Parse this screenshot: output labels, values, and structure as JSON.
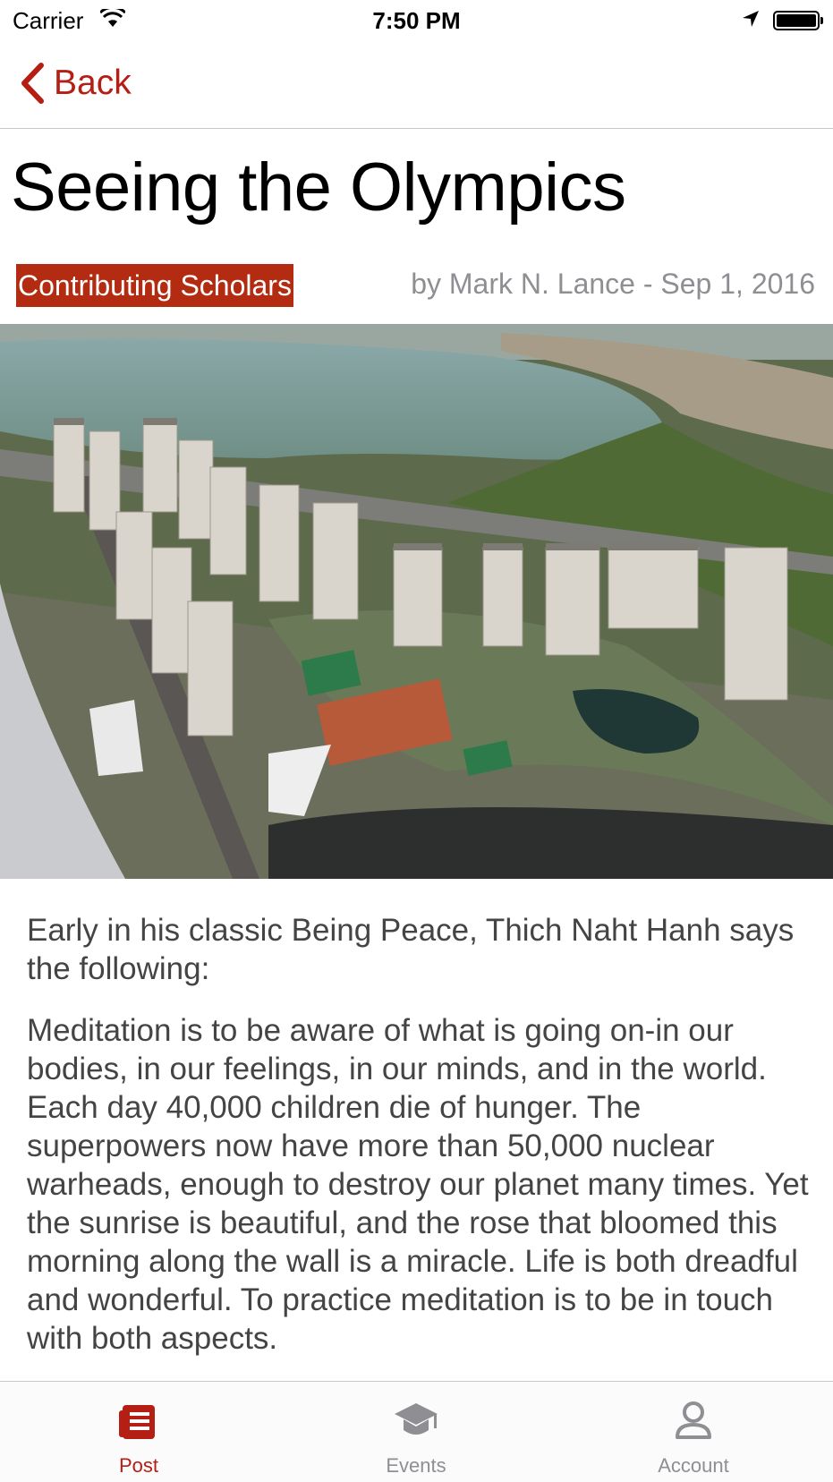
{
  "status_bar": {
    "carrier": "Carrier",
    "time": "7:50 PM",
    "icons": [
      "wifi-icon",
      "location-arrow-icon",
      "battery-icon"
    ]
  },
  "nav": {
    "back_label": "Back",
    "back_icon": "chevron-left-icon"
  },
  "article": {
    "title": "Seeing the Olympics",
    "category": "Contributing Scholars",
    "byline": "by Mark N. Lance - Sep 1, 2016",
    "image_alt": "Aerial view of the Olympic village",
    "paragraphs": [
      "Early in his classic Being Peace, Thich Naht Hanh says the following:",
      "Meditation is to be aware of what is going on-in our bodies, in our feelings, in our minds, and in the world. Each day 40,000 children die of hunger. The superpowers now have more than 50,000 nuclear warheads, enough to destroy our planet many times. Yet the sunrise is beautiful, and the rose that bloomed this morning along the wall is a miracle. Life is both dreadful and wonderful. To practice meditation is to be in touch with both aspects."
    ]
  },
  "tab_bar": {
    "tabs": [
      {
        "label": "Post",
        "icon": "document-icon",
        "active": true
      },
      {
        "label": "Events",
        "icon": "graduation-cap-icon",
        "active": false
      },
      {
        "label": "Account",
        "icon": "person-icon",
        "active": false
      }
    ]
  },
  "colors": {
    "accent": "#b41e13",
    "badge": "#b32c12",
    "byline": "#8e8e93",
    "body_text": "#444444",
    "tab_inactive": "#8e8e93"
  }
}
